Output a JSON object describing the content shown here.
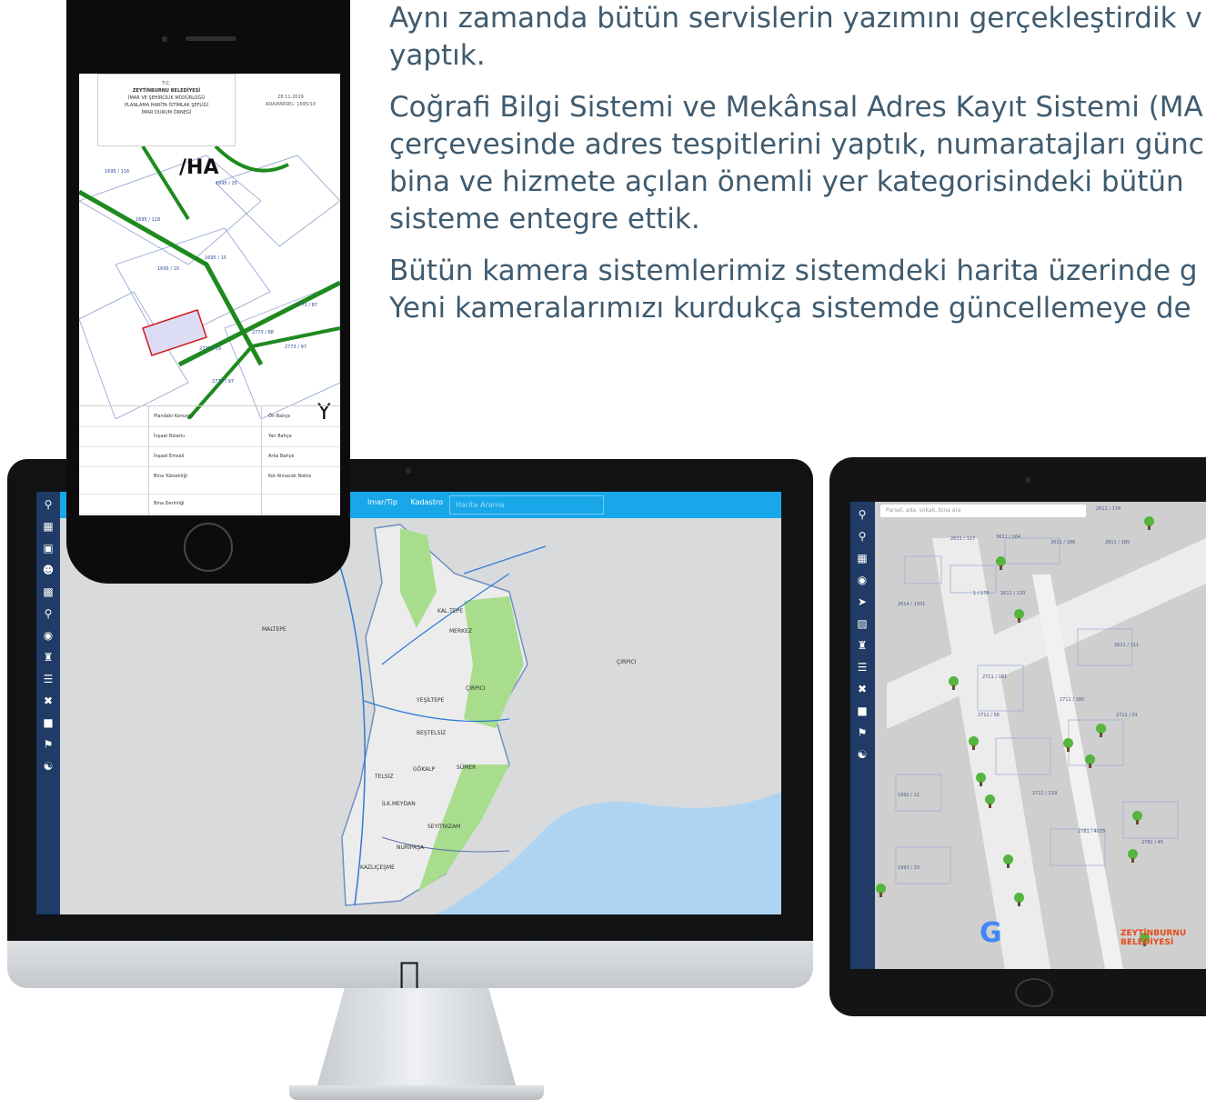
{
  "article": {
    "paragraphs": [
      {
        "lines": [
          "Aynı zamanda bütün servislerin yazımını gerçekleştirdik v",
          "yaptık."
        ]
      },
      {
        "lines": [
          "Coğrafi Bilgi Sistemi ve Mekânsal Adres Kayıt Sistemi (MA",
          "çerçevesinde adres tespitlerini yaptık, numaratajları günc",
          "bina ve hizmete açılan önemli yer kategorisindeki bütün",
          "sisteme entegre ettik."
        ]
      },
      {
        "lines": [
          "Bütün kamera sistemlerimiz sistemdeki harita üzerinde g",
          "Yeni kameralarımızı kurdukça sistemde güncellemeye de"
        ]
      }
    ]
  },
  "desktop": {
    "menu": [
      "Imar/Tip",
      "Kadastro"
    ],
    "search_placeholder": "Harita Arama",
    "sidebar_icons": [
      "search-icon",
      "document-icon",
      "image-icon",
      "person-icon",
      "building-icon",
      "pin-icon",
      "target-icon",
      "castle-icon",
      "cart-icon",
      "tools-icon",
      "bus-icon",
      "flag-icon",
      "group-icon"
    ],
    "map_labels": [
      "KAL.TEPE",
      "MERKEZ",
      "ÇIRPICI",
      "YEŞİLTEPE",
      "BEŞTELSİZ",
      "SÜMER",
      "GÖKALP",
      "TELSİZ",
      "İLK.MEYDAN",
      "SEYITNIZAM",
      "NURİPAŞA",
      "KAZLIÇEŞME",
      "MALTEPE",
      "ÇIRPICI"
    ]
  },
  "tablet": {
    "search_placeholder": "Parsel, ada, sokak, bina ara",
    "block_labels": [
      "2611 / 174",
      "2611 / 117",
      "3611 / 164",
      "2611 / 186",
      "2611 / 185",
      "2614 / 1501",
      "1 / 178",
      "2611 / 120",
      "2611 / 111",
      "2711 / 181",
      "2711 / 180",
      "2711 / 56",
      "2711 / 01",
      "2711 / 219",
      "2781 / 4025",
      "2781 / 45",
      "1992 / 11",
      "1993 / 33"
    ],
    "brand_line1": "ZEYTİNBURNU",
    "brand_line2": "BELEDİYESİ",
    "google_letter": "G"
  },
  "phone": {
    "header_lines": [
      "T.C.",
      "ZEYTİNBURNU BELEDİYESİ",
      "İMAR VE ŞEHİRCİLİK MÜDÜRLÜĞÜ",
      "PLANLAMA HARİTA İSTİMLAK ŞEFLİĞİ",
      "İMAR DURUM ÖRNEĞİ"
    ],
    "date_lines": [
      "28.11.2019",
      "ADA/PARSEL: 1695/10"
    ],
    "parcel_labels": [
      "1695 / 116",
      "1695 / 25",
      "1695 / 118",
      "1695 / 15",
      "1695 / 10",
      "2773 / 87",
      "2773 / 59",
      "2773 / 88",
      "2773 / 97",
      "2773 / 97"
    ],
    "table_rows": [
      [
        "Plandaki Konumu",
        "Ön Bahçe"
      ],
      [
        "İnşaat Nizamı",
        "Yan Bahçe"
      ],
      [
        "İnşaat Emsali",
        "Arka Bahçe"
      ],
      [
        "Bina Yüksekliği",
        "Kot Alınacak Nokta"
      ],
      [
        "Bina Derinliği",
        ""
      ]
    ]
  }
}
